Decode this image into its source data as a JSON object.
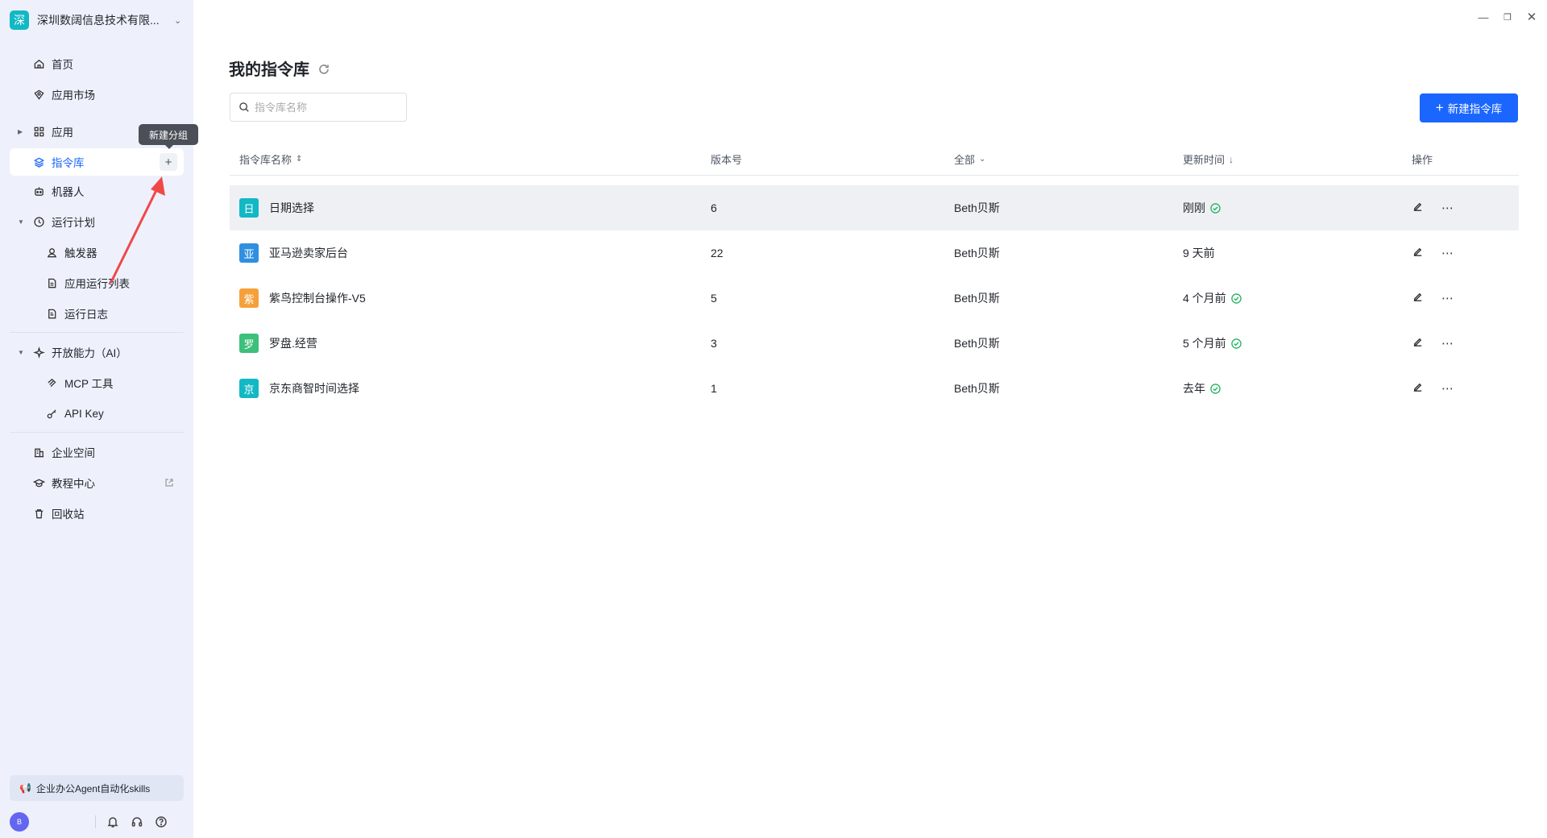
{
  "org": {
    "badge": "深",
    "name": "深圳数阔信息技术有限..."
  },
  "nav": {
    "home": "首页",
    "market": "应用市场",
    "apps": "应用",
    "library": "指令库",
    "robots": "机器人",
    "plan": "运行计划",
    "trigger": "触发器",
    "app_run_list": "应用运行列表",
    "run_log": "运行日志",
    "open_ai": "开放能力（AI）",
    "mcp": "MCP 工具",
    "apikey": "API Key",
    "enterprise": "企业空间",
    "tutorial": "教程中心",
    "recycle": "回收站"
  },
  "tooltip": "新建分组",
  "promo": "企业办公Agent自动化skills",
  "user": {
    "avatar": "B"
  },
  "page": {
    "title": "我的指令库",
    "search_placeholder": "指令库名称",
    "new_button": "新建指令库"
  },
  "table": {
    "headers": {
      "name": "指令库名称",
      "version": "版本号",
      "owner": "全部",
      "updated": "更新时间",
      "actions": "操作"
    },
    "rows": [
      {
        "badge": "日",
        "badge_color": "#12b8c4",
        "name": "日期选择",
        "version": "6",
        "owner": "Beth贝斯",
        "updated": "刚刚",
        "verified": true
      },
      {
        "badge": "亚",
        "badge_color": "#2f8fe0",
        "name": "亚马逊卖家后台",
        "version": "22",
        "owner": "Beth贝斯",
        "updated": "9 天前",
        "verified": false
      },
      {
        "badge": "紫",
        "badge_color": "#f5a03a",
        "name": "紫鸟控制台操作-V5",
        "version": "5",
        "owner": "Beth贝斯",
        "updated": "4 个月前",
        "verified": true
      },
      {
        "badge": "罗",
        "badge_color": "#3cc07a",
        "name": "罗盘.经营",
        "version": "3",
        "owner": "Beth贝斯",
        "updated": "5 个月前",
        "verified": true
      },
      {
        "badge": "京",
        "badge_color": "#12b8c4",
        "name": "京东商智时间选择",
        "version": "1",
        "owner": "Beth贝斯",
        "updated": "去年",
        "verified": true
      }
    ]
  },
  "colors": {
    "accent": "#1a66ff",
    "verified": "#22b35e"
  }
}
